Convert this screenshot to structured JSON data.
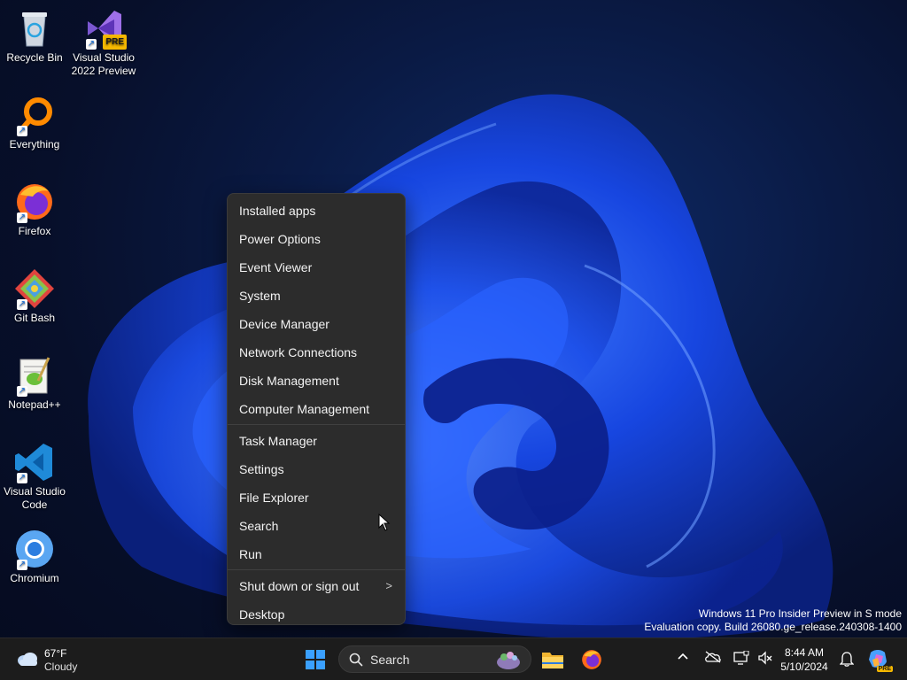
{
  "desktop": {
    "icons": [
      {
        "label": "Recycle Bin",
        "icon": "recycle-bin-icon"
      },
      {
        "label": "Visual Studio 2022 Preview",
        "icon": "visual-studio-preview-icon",
        "badge": "PRE"
      },
      {
        "label": "Everything",
        "icon": "everything-search-icon"
      },
      {
        "label": "Firefox",
        "icon": "firefox-icon"
      },
      {
        "label": "Git Bash",
        "icon": "git-bash-icon"
      },
      {
        "label": "Notepad++",
        "icon": "notepad-plus-plus-icon"
      },
      {
        "label": "Visual Studio Code",
        "icon": "vscode-icon"
      },
      {
        "label": "Chromium",
        "icon": "chromium-icon"
      }
    ]
  },
  "context_menu": {
    "group1": [
      "Installed apps",
      "Power Options",
      "Event Viewer",
      "System",
      "Device Manager",
      "Network Connections",
      "Disk Management",
      "Computer Management"
    ],
    "group2": [
      "Task Manager",
      "Settings",
      "File Explorer",
      "Search",
      "Run"
    ],
    "group3": [
      "Shut down or sign out",
      "Desktop"
    ],
    "submenu_chevron": ">"
  },
  "watermark": {
    "line1": "Windows 11 Pro Insider Preview in S mode",
    "line2": "Evaluation copy. Build 26080.ge_release.240308-1400"
  },
  "taskbar": {
    "weather": {
      "temp": "67°F",
      "condition": "Cloudy",
      "icon": "cloudy-weather-icon"
    },
    "search_placeholder": "Search",
    "pinned": [
      "windows-start-icon",
      "file-explorer-icon",
      "firefox-icon"
    ],
    "clock": {
      "time": "8:44 AM",
      "date": "5/10/2024"
    },
    "tray_icons": [
      "chevron-up-icon",
      "onedrive-offline-icon",
      "display-icon",
      "mute-speaker-icon",
      "notification-bell-icon",
      "copilot-icon"
    ],
    "copilot_badge": "PRE"
  },
  "colors": {
    "menu_bg": "#2c2c2c",
    "taskbar_bg": "#1c1c1c",
    "accent": "#1a5cff"
  }
}
